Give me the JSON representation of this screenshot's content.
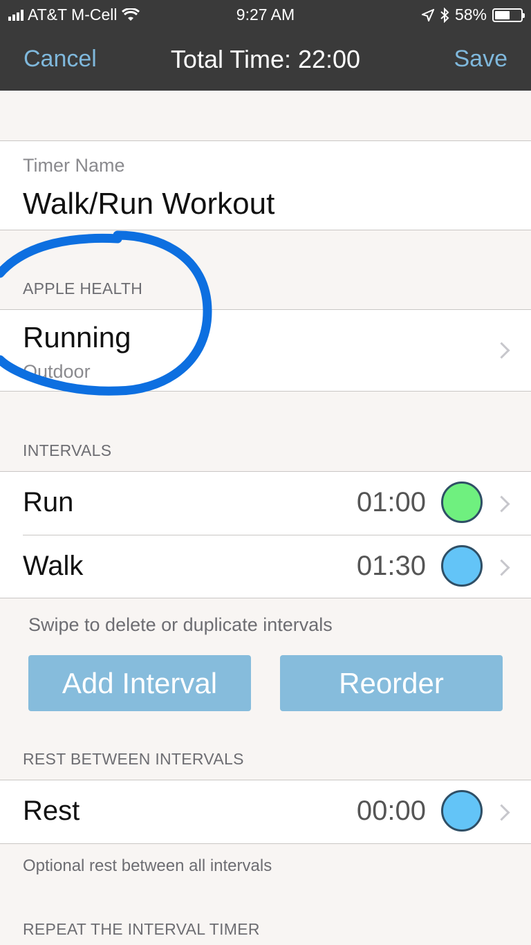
{
  "status_bar": {
    "carrier": "AT&T M-Cell",
    "time": "9:27 AM",
    "battery": "58%",
    "battery_level": 0.58,
    "icons": [
      "signal-icon",
      "wifi-icon",
      "location-icon",
      "bluetooth-icon",
      "battery-icon"
    ]
  },
  "nav": {
    "cancel_label": "Cancel",
    "title": "Total Time: 22:00",
    "save_label": "Save"
  },
  "timer_name": {
    "label": "Timer Name",
    "value": "Walk/Run Workout"
  },
  "apple_health": {
    "header": "APPLE HEALTH",
    "activity": "Running",
    "location": "Outdoor"
  },
  "intervals": {
    "header": "INTERVALS",
    "items": [
      {
        "name": "Run",
        "duration": "01:00",
        "color": "#6ff07f"
      },
      {
        "name": "Walk",
        "duration": "01:30",
        "color": "#63c4f7"
      }
    ],
    "hint": "Swipe to delete or duplicate intervals",
    "add_label": "Add Interval",
    "reorder_label": "Reorder"
  },
  "rest": {
    "header": "REST BETWEEN INTERVALS",
    "name": "Rest",
    "duration": "00:00",
    "color": "#63c4f7",
    "footer": "Optional rest between all intervals"
  },
  "repeat": {
    "header": "REPEAT THE INTERVAL TIMER"
  },
  "colors": {
    "accent": "#7fb8dc",
    "button": "#86bcdc",
    "annotation": "#0d6fe0"
  }
}
